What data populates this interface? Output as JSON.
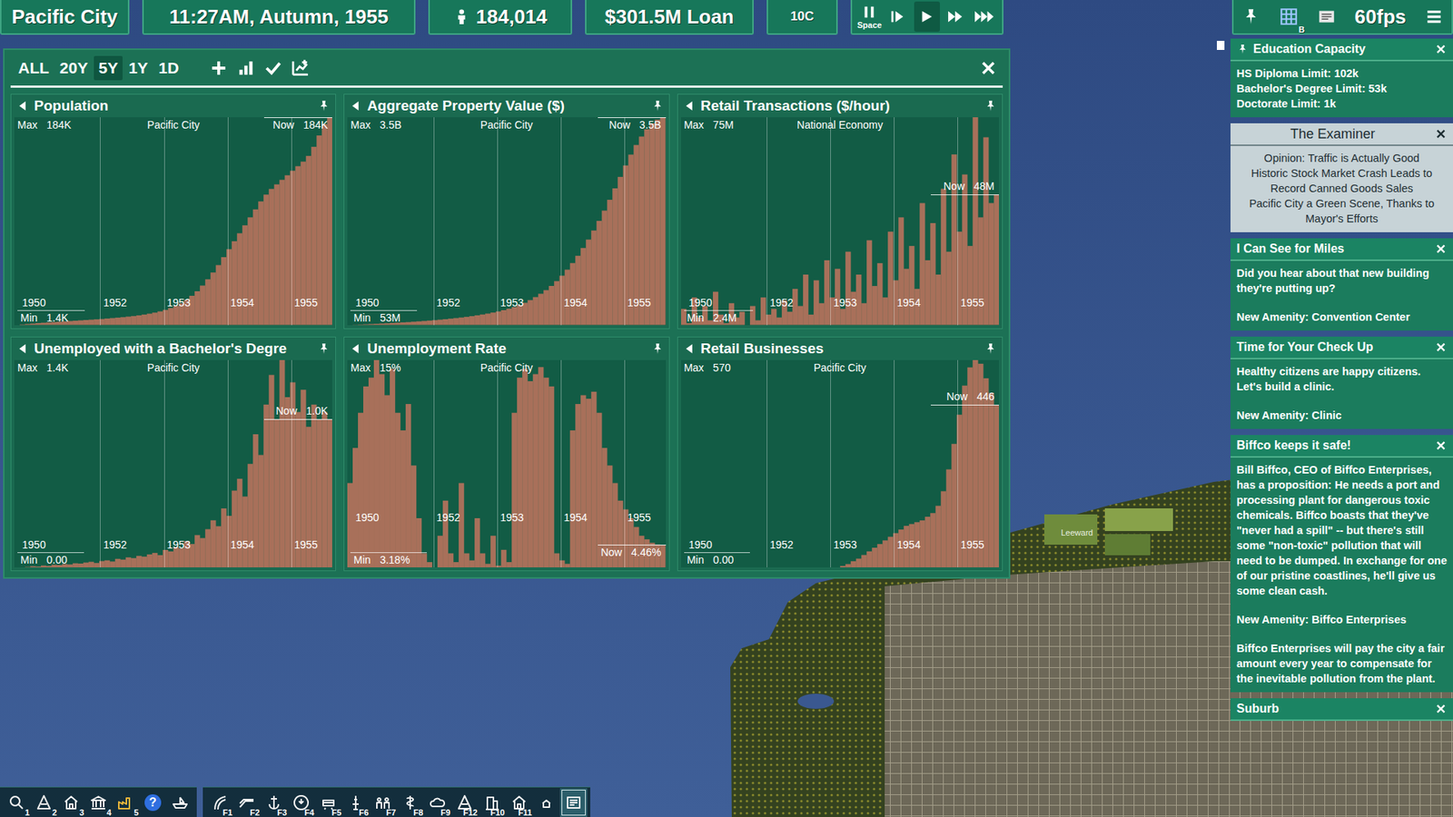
{
  "top_bar": {
    "city": "Pacific City",
    "datetime": "11:27AM, Autumn, 1955",
    "population": "184,014",
    "loan": "$301.5M Loan",
    "temperature": "10C",
    "speed_controls": [
      {
        "kind": "pause",
        "hint": "Space",
        "selected": false
      },
      {
        "kind": "step",
        "hint": "",
        "selected": false
      },
      {
        "kind": "play",
        "hint": "",
        "selected": true
      },
      {
        "kind": "fast",
        "hint": "",
        "selected": false
      },
      {
        "kind": "fastest",
        "hint": "",
        "selected": false
      }
    ],
    "overlay_key": "B",
    "fps": "60fps"
  },
  "panel": {
    "ranges": [
      {
        "label": "ALL",
        "selected": false
      },
      {
        "label": "20Y",
        "selected": false
      },
      {
        "label": "5Y",
        "selected": true
      },
      {
        "label": "1Y",
        "selected": false
      },
      {
        "label": "1D",
        "selected": false
      }
    ],
    "labels": {
      "max": "Max",
      "min": "Min",
      "now": "Now"
    },
    "charts": [
      {
        "title": "Population",
        "region": "Pacific City",
        "max": "184K",
        "min": "1.4K",
        "now": "184K",
        "ticks": [
          "1950",
          "1952",
          "1953",
          "1954",
          "1955"
        ],
        "values": [
          1400,
          1800,
          2200,
          2600,
          3000,
          3300,
          3600,
          3900,
          4200,
          4500,
          4800,
          5100,
          5400,
          5700,
          6000,
          6300,
          6600,
          7000,
          7400,
          7800,
          8200,
          8700,
          9200,
          9800,
          10500,
          11300,
          12200,
          13300,
          14600,
          16200,
          18000,
          20500,
          23500,
          27000,
          31000,
          36000,
          41500,
          47500,
          54000,
          61000,
          68000,
          75000,
          82000,
          89000,
          96000,
          103000,
          110000,
          116000,
          121000,
          125000,
          129000,
          133000,
          137000,
          141000,
          145000,
          150000,
          158000,
          168000,
          178000,
          184014
        ]
      },
      {
        "title": "Aggregate Property Value ($)",
        "region": "Pacific City",
        "max": "3.5B",
        "min": "53M",
        "now": "3.5B",
        "ticks": [
          "1950",
          "1952",
          "1953",
          "1954",
          "1955"
        ],
        "values": [
          53000000,
          56000000,
          60000000,
          64000000,
          68000000,
          72000000,
          76000000,
          80000000,
          85000000,
          90000000,
          95000000,
          100000000,
          106000000,
          112000000,
          118000000,
          125000000,
          132000000,
          140000000,
          148000000,
          157000000,
          166000000,
          176000000,
          187000000,
          199000000,
          212000000,
          226000000,
          241000000,
          258000000,
          277000000,
          298000000,
          322000000,
          350000000,
          382000000,
          420000000,
          465000000,
          515000000,
          570000000,
          630000000,
          700000000,
          780000000,
          870000000,
          970000000,
          1080000000,
          1200000000,
          1330000000,
          1470000000,
          1620000000,
          1780000000,
          1950000000,
          2130000000,
          2320000000,
          2510000000,
          2700000000,
          2880000000,
          3040000000,
          3180000000,
          3300000000,
          3400000000,
          3460000000,
          3500000000
        ]
      },
      {
        "title": "Retail Transactions ($/hour)",
        "region": "National Economy",
        "max": "75M",
        "min": "2.4M",
        "now": "48M",
        "ticks": [
          "1950",
          "1952",
          "1953",
          "1954",
          "1955"
        ],
        "values": [
          8000000,
          3000000,
          12000000,
          5000000,
          9000000,
          4000000,
          14000000,
          6000000,
          3000000,
          10000000,
          5000000,
          7000000,
          2400000,
          9000000,
          4000000,
          12000000,
          6000000,
          8000000,
          5000000,
          11000000,
          7000000,
          15000000,
          9000000,
          20000000,
          6000000,
          18000000,
          10000000,
          25000000,
          12000000,
          22000000,
          8000000,
          28000000,
          14000000,
          20000000,
          10000000,
          32000000,
          16000000,
          24000000,
          12000000,
          35000000,
          18000000,
          40000000,
          22000000,
          30000000,
          15000000,
          45000000,
          25000000,
          38000000,
          20000000,
          50000000,
          28000000,
          62000000,
          35000000,
          55000000,
          30000000,
          75000000,
          40000000,
          68000000,
          45000000,
          48000000
        ]
      },
      {
        "title": "Unemployed with a Bachelor's Degre",
        "region": "Pacific City",
        "max": "1.4K",
        "min": "0.00",
        "now": "1.0K",
        "ticks": [
          "1950",
          "1952",
          "1953",
          "1954",
          "1955"
        ],
        "values": [
          0,
          0,
          5,
          10,
          8,
          15,
          12,
          20,
          18,
          25,
          22,
          30,
          28,
          35,
          40,
          32,
          45,
          50,
          42,
          60,
          55,
          70,
          65,
          80,
          75,
          90,
          100,
          85,
          120,
          110,
          140,
          130,
          180,
          160,
          220,
          200,
          260,
          320,
          280,
          400,
          350,
          520,
          600,
          480,
          700,
          900,
          760,
          1100,
          1300,
          1000,
          1400,
          1150,
          1250,
          1050,
          1200,
          950,
          1100,
          1000,
          1050,
          1000
        ]
      },
      {
        "title": "Unemployment Rate",
        "region": "Pacific City",
        "max": "15%",
        "min": "3.18%",
        "now": "4.46%",
        "ticks": [
          "1950",
          "1952",
          "1953",
          "1954",
          "1955"
        ],
        "values": [
          8,
          10,
          12,
          13.5,
          14,
          15,
          14.2,
          13,
          14.5,
          12,
          11,
          12.5,
          9,
          6,
          4,
          3.5,
          3.18,
          5,
          7,
          4,
          3.5,
          8,
          4,
          3.6,
          6,
          4,
          3.4,
          5,
          3.3,
          4.2,
          3.5,
          12,
          14,
          14.5,
          13.8,
          14.2,
          14.6,
          14,
          13.5,
          4,
          3.6,
          3.4,
          11,
          12.5,
          13,
          12.8,
          13.2,
          12,
          10,
          9,
          8,
          7,
          6.5,
          6,
          5.5,
          5,
          4.8,
          4.6,
          4.5,
          4.46
        ]
      },
      {
        "title": "Retail Businesses",
        "region": "Pacific City",
        "max": "570",
        "min": "0.00",
        "now": "446",
        "ticks": [
          "1950",
          "1952",
          "1953",
          "1954",
          "1955"
        ],
        "values": [
          0,
          0,
          0,
          0,
          0,
          0,
          0,
          0,
          0,
          0,
          0,
          0,
          0,
          0,
          0,
          0,
          0,
          0,
          0,
          0,
          0,
          0,
          0,
          0,
          0,
          0,
          0,
          0,
          0,
          0,
          5,
          10,
          18,
          25,
          35,
          45,
          55,
          65,
          75,
          85,
          95,
          105,
          115,
          120,
          125,
          130,
          140,
          150,
          170,
          210,
          270,
          340,
          420,
          500,
          550,
          570,
          560,
          520,
          480,
          446
        ]
      }
    ]
  },
  "sidebar": {
    "cards": [
      {
        "kind": "pinned",
        "pinned": true,
        "title": "Education Capacity",
        "lines": [
          "HS Diploma Limit: 102k",
          "Bachelor's Degree Limit: 53k",
          "Doctorate Limit: 1k"
        ]
      },
      {
        "kind": "news",
        "pinned": false,
        "title": "The Examiner",
        "lines": [
          "Opinion: Traffic is Actually Good",
          "Historic Stock Market Crash Leads to Record Canned Goods Sales",
          "Pacific City a Green Scene, Thanks to Mayor's Efforts"
        ]
      },
      {
        "kind": "notice",
        "pinned": false,
        "title": "I Can See for Miles",
        "lines": [
          "Did you hear about that new building they're putting up?",
          "New Amenity: Convention Center"
        ]
      },
      {
        "kind": "notice",
        "pinned": false,
        "title": "Time for Your Check Up",
        "lines": [
          "Healthy citizens are happy citizens. Let's build a clinic.",
          "New Amenity: Clinic"
        ]
      },
      {
        "kind": "notice",
        "pinned": false,
        "title": "Biffco keeps it safe!",
        "lines": [
          "Bill Biffco, CEO of Biffco Enterprises, has a proposition: He needs a port and processing plant for dangerous toxic chemicals. Biffco boasts that they've \"never had a spill\" -- but there's still some \"non-toxic\" pollution that will need to be dumped. In exchange for one of our pristine coastlines, he'll give us some clean cash.",
          "New Amenity: Biffco Enterprises",
          "Biffco Enterprises will pay the city a fair amount every year to compensate for the inevitable pollution from the plant."
        ]
      },
      {
        "kind": "notice",
        "pinned": false,
        "title": "Suburb",
        "lines": []
      }
    ]
  },
  "map": {
    "labels": [
      "Leeward"
    ]
  },
  "toolbar": {
    "groups": [
      {
        "items": [
          {
            "kind": "search",
            "key": "1",
            "glyph": "",
            "selected": false
          },
          {
            "kind": "zone",
            "key": "2",
            "glyph": "",
            "selected": false
          },
          {
            "kind": "house",
            "key": "3",
            "glyph": "",
            "selected": false
          },
          {
            "kind": "civic",
            "key": "4",
            "glyph": "",
            "selected": false
          },
          {
            "kind": "industry",
            "key": "5",
            "glyph": "",
            "selected": false
          },
          {
            "kind": "help",
            "key": "",
            "glyph": "?",
            "selected": false
          },
          {
            "kind": "boat",
            "key": "",
            "glyph": "",
            "selected": false
          }
        ]
      },
      {
        "items": [
          {
            "kind": "road",
            "key": "F1",
            "glyph": "",
            "selected": false
          },
          {
            "kind": "highway",
            "key": "F2",
            "glyph": "",
            "selected": false
          },
          {
            "kind": "port",
            "key": "F3",
            "glyph": "",
            "selected": false
          },
          {
            "kind": "power",
            "key": "F4",
            "glyph": "",
            "selected": false
          },
          {
            "kind": "transit",
            "key": "F5",
            "glyph": "",
            "selected": false
          },
          {
            "kind": "tower",
            "key": "F6",
            "glyph": "",
            "selected": false
          },
          {
            "kind": "people",
            "key": "F7",
            "glyph": "",
            "selected": false
          },
          {
            "kind": "health",
            "key": "F8",
            "glyph": "",
            "selected": false
          },
          {
            "kind": "weather",
            "key": "F9",
            "glyph": "",
            "selected": false
          },
          {
            "kind": "cone",
            "key": "F12",
            "glyph": "",
            "selected": false
          },
          {
            "kind": "building",
            "key": "F10",
            "glyph": "",
            "selected": false
          },
          {
            "kind": "home",
            "key": "F11",
            "glyph": "",
            "selected": false
          },
          {
            "kind": "small-home",
            "key": "",
            "glyph": "",
            "selected": false
          },
          {
            "kind": "news",
            "key": "",
            "glyph": "",
            "selected": true
          }
        ]
      }
    ]
  }
}
